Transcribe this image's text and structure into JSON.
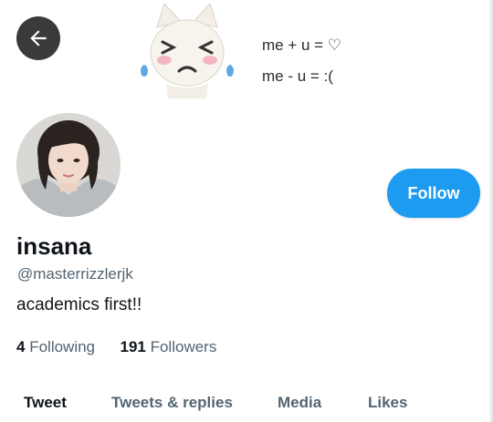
{
  "banner": {
    "line1": "me + u = ♡",
    "line2": "me - u = :("
  },
  "profile": {
    "name": "insana",
    "handle": "@masterrizzlerjk",
    "bio": "academics first!!",
    "following_count": "4",
    "following_label": "Following",
    "followers_count": "191",
    "followers_label": "Followers",
    "follow_button": "Follow"
  },
  "tabs": [
    {
      "label": "Tweet",
      "active": true
    },
    {
      "label": "Tweets & replies",
      "active": false
    },
    {
      "label": "Media",
      "active": false
    },
    {
      "label": "Likes",
      "active": false
    }
  ],
  "colors": {
    "accent": "#1d9bf0",
    "text_primary": "#0f1419",
    "text_secondary": "#536471"
  },
  "icons": {
    "back": "arrow-left-icon"
  }
}
